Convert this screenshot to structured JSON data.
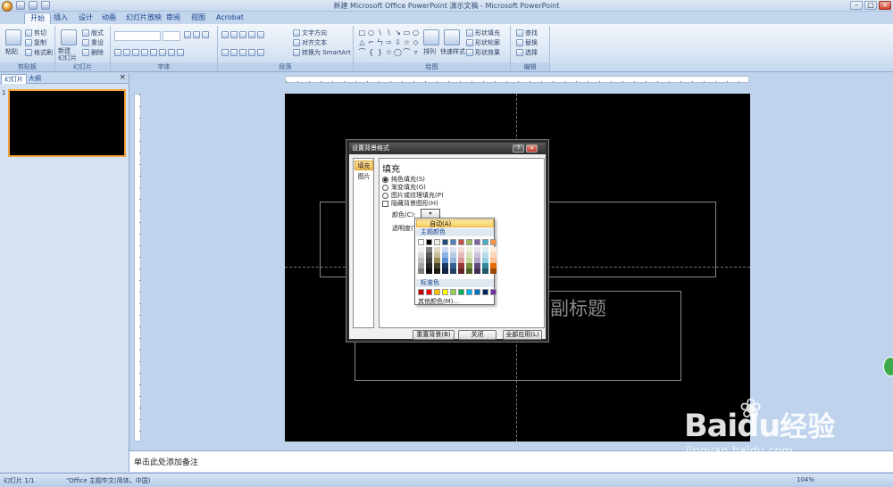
{
  "window": {
    "title": "新建 Microsoft Office PowerPoint 演示文稿 - Microsoft PowerPoint",
    "controls": [
      "–",
      "□",
      "×"
    ]
  },
  "tabs": [
    "开始",
    "插入",
    "设计",
    "动画",
    "幻灯片放映",
    "审阅",
    "视图",
    "Acrobat"
  ],
  "ribbon": {
    "clipboard": {
      "label": "剪贴板",
      "paste": "粘贴",
      "cut": "剪切",
      "copy": "复制",
      "format_painter": "格式刷"
    },
    "slides": {
      "label": "幻灯片",
      "new_slide": "新建\n幻灯片",
      "layout": "版式",
      "reset": "重设",
      "delete": "删除"
    },
    "font": {
      "label": "字体"
    },
    "paragraph": {
      "label": "段落",
      "text_direction": "文字方向",
      "align_text": "对齐文本",
      "smartart": "转换为 SmartArt"
    },
    "drawing": {
      "label": "绘图",
      "arrange": "排列",
      "quick_styles": "快速样式",
      "shape_fill": "形状填充",
      "shape_outline": "形状轮廓",
      "shape_effects": "形状效果"
    },
    "editing": {
      "label": "编辑",
      "find": "查找",
      "replace": "替换",
      "select": "选择"
    }
  },
  "left_panel": {
    "tabs": [
      "幻灯片",
      "大纲"
    ],
    "close": "×",
    "slide_number": "1"
  },
  "slide": {
    "subtitle": "副标题"
  },
  "dialog": {
    "title": "设置背景格式",
    "help": "?",
    "close": "×",
    "nav": [
      "填充",
      "图片"
    ],
    "heading": "填充",
    "options": {
      "solid": "纯色填充(S)",
      "gradient": "渐变填充(G)",
      "picture": "图片或纹理填充(P)",
      "hide_graphics": "隐藏背景图形(H)"
    },
    "color_label": "颜色(C):",
    "transparency_label": "透明度(T):",
    "buttons": {
      "reset": "重置背景(B)",
      "close": "关闭",
      "apply_all": "全部应用(L)"
    }
  },
  "color_dropdown": {
    "automatic": "自动(A)",
    "theme_title": "主题颜色",
    "standard_title": "标准色",
    "more": "其他颜色(M)...",
    "theme_top": [
      "#ffffff",
      "#000000",
      "#eeece1",
      "#1f497d",
      "#4f81bd",
      "#c0504d",
      "#9bbb59",
      "#8064a2",
      "#4bacc6",
      "#f79646"
    ],
    "theme_shades": [
      [
        "#f2f2f2",
        "#d8d8d8",
        "#bfbfbf",
        "#a5a5a5",
        "#7f7f7f"
      ],
      [
        "#7f7f7f",
        "#595959",
        "#3f3f3f",
        "#262626",
        "#0c0c0c"
      ],
      [
        "#ddd9c3",
        "#c4bd97",
        "#938953",
        "#494429",
        "#1d1b10"
      ],
      [
        "#c6d9f0",
        "#8db3e2",
        "#548dd4",
        "#17365d",
        "#0f243e"
      ],
      [
        "#dbe5f1",
        "#b8cce4",
        "#95b3d7",
        "#366092",
        "#244061"
      ],
      [
        "#f2dcdb",
        "#e5b9b7",
        "#d99694",
        "#953734",
        "#632423"
      ],
      [
        "#ebf1dd",
        "#d7e3bc",
        "#c3d69b",
        "#76923c",
        "#4f6128"
      ],
      [
        "#e5e0ec",
        "#ccc1d9",
        "#b2a2c7",
        "#5f497a",
        "#3f3151"
      ],
      [
        "#dbeef3",
        "#b7dde8",
        "#92cddc",
        "#31859b",
        "#205867"
      ],
      [
        "#fdeada",
        "#fbd5b5",
        "#fac08f",
        "#e36c09",
        "#974806"
      ]
    ],
    "standard": [
      "#c00000",
      "#ff0000",
      "#ffc000",
      "#ffff00",
      "#92d050",
      "#00b050",
      "#00b0f0",
      "#0070c0",
      "#002060",
      "#7030a0"
    ]
  },
  "notes": {
    "placeholder": "单击此处添加备注"
  },
  "status": {
    "slide": "幻灯片 1/1",
    "theme": "\"Office 主题\"",
    "language": "中文(简体，中国)",
    "zoom": "104%"
  },
  "watermark": {
    "brand": "Bai",
    "brand2": "du",
    "product": "经验",
    "url": "jingyan.baidu.com"
  }
}
